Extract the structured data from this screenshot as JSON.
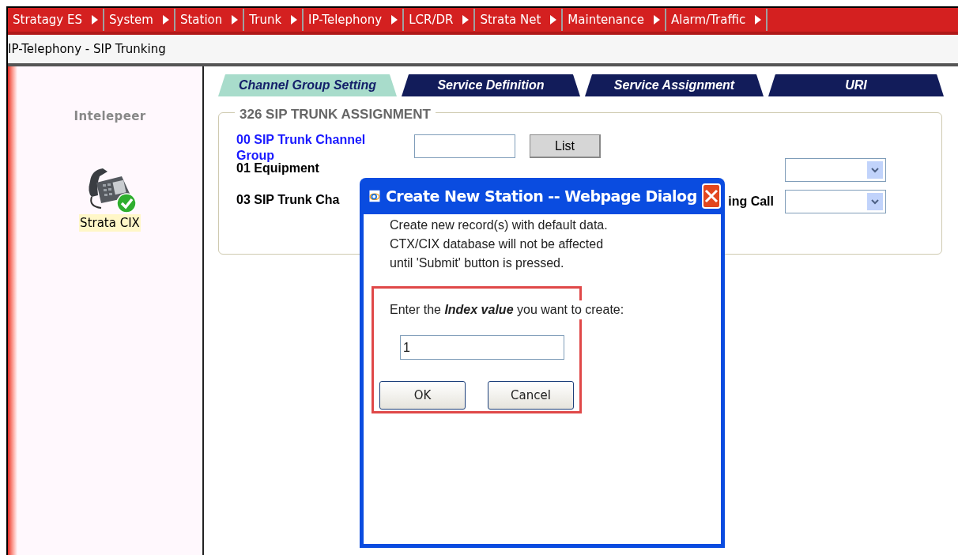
{
  "menu": [
    {
      "label": "Stratagy ES"
    },
    {
      "label": "System"
    },
    {
      "label": "Station"
    },
    {
      "label": "Trunk"
    },
    {
      "label": "IP-Telephony"
    },
    {
      "label": "LCR/DR"
    },
    {
      "label": "Strata Net"
    },
    {
      "label": "Maintenance"
    },
    {
      "label": "Alarm/Traffic"
    }
  ],
  "breadcrumb": "IP-Telephony - SIP Trunking",
  "sidebar": {
    "title": "Intelepeer",
    "device": {
      "label": "Strata CIX",
      "online": true
    }
  },
  "tabs": [
    {
      "label": "Channel Group Setting",
      "selected": true
    },
    {
      "label": "Service Definition",
      "selected": false
    },
    {
      "label": "Service Assignment",
      "selected": false
    },
    {
      "label": "URI",
      "selected": false
    }
  ],
  "section": {
    "title": "326 SIP TRUNK ASSIGNMENT",
    "rows": [
      {
        "kind": "input",
        "label": "00 SIP Trunk Channel Group",
        "link": true,
        "button": "List"
      },
      {
        "kind": "select",
        "label": "01 Equipment",
        "link": false
      },
      {
        "kind": "select",
        "label": "03 SIP Trunk Cha",
        "link": false,
        "label_end": "ing Call"
      }
    ]
  },
  "dialog": {
    "title": "Create New Station -- Webpage Dialog",
    "message": [
      "Create new record(s) with default data.",
      "CTX/CIX database will not be affected",
      "until 'Submit' button is pressed."
    ],
    "prompt": "Enter the *Index value* you want to create:",
    "value": "1",
    "buttons": [
      "OK",
      "Cancel"
    ],
    "highlighted": true
  }
}
